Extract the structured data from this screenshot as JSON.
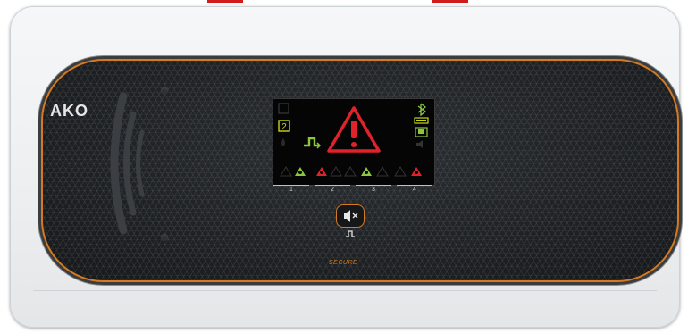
{
  "device": {
    "brand": "AKO",
    "footer_text": "SECURE",
    "zones": [
      {
        "label": "1"
      },
      {
        "label": "2"
      },
      {
        "label": "3"
      },
      {
        "label": "4"
      }
    ]
  },
  "display": {
    "indicators": {
      "zone_number_active": "2",
      "main_alarm_icon": "warning-triangle-icon",
      "status_icons": [
        "bluetooth-icon",
        "battery-icon",
        "network-icon",
        "speaker-icon"
      ]
    }
  },
  "colors": {
    "accent_orange": "#d47a22",
    "alarm_red": "#e0222b",
    "status_green": "#8cc63f",
    "indicator_yellow": "#c8d41e"
  }
}
